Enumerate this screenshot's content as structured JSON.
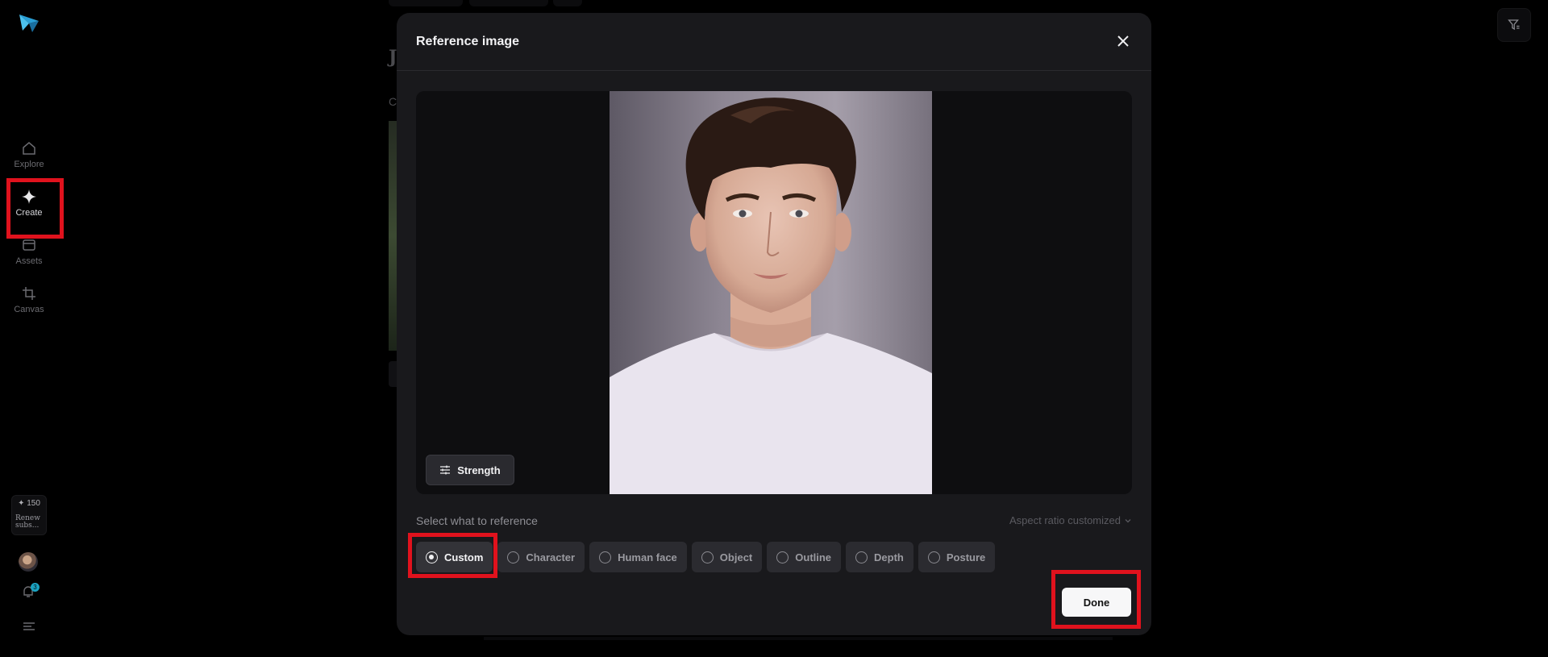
{
  "sidebar": {
    "items": [
      {
        "label": "Explore",
        "icon": "home-icon"
      },
      {
        "label": "Create",
        "icon": "sparkle-icon"
      },
      {
        "label": "Assets",
        "icon": "folder-icon"
      },
      {
        "label": "Canvas",
        "icon": "crop-icon"
      }
    ],
    "credits": {
      "count": "✦ 150",
      "renew": "Renew subs..."
    },
    "notifications_badge": "3"
  },
  "modal": {
    "title": "Reference image",
    "strength_label": "Strength",
    "select_label": "Select what to reference",
    "aspect_label": "Aspect ratio customized",
    "options": [
      {
        "label": "Custom",
        "selected": true
      },
      {
        "label": "Character",
        "selected": false
      },
      {
        "label": "Human face",
        "selected": false
      },
      {
        "label": "Object",
        "selected": false
      },
      {
        "label": "Outline",
        "selected": false
      },
      {
        "label": "Depth",
        "selected": false
      },
      {
        "label": "Posture",
        "selected": false
      }
    ],
    "done_label": "Done"
  },
  "background": {
    "letter": "J",
    "letter2": "C"
  },
  "colors": {
    "accent_red": "#e0121d",
    "modal_bg": "#19191c",
    "badge": "#1ba2c0"
  }
}
